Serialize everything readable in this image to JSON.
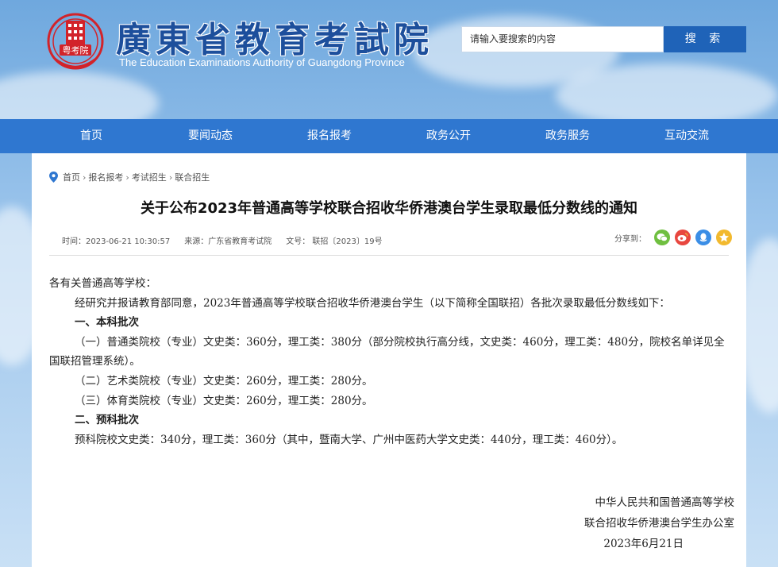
{
  "header": {
    "site_title": "廣東省教育考試院",
    "site_subtitle": "The Education Examinations Authority of Guangdong Province",
    "emblem_text": "粤考院",
    "search_value": "请输入要搜索的内容",
    "search_button": "搜 索"
  },
  "nav": {
    "items": [
      "首页",
      "要闻动态",
      "报名报考",
      "政务公开",
      "政务服务",
      "互动交流"
    ]
  },
  "breadcrumb": [
    "首页",
    "报名报考",
    "考试招生",
    "联合招生"
  ],
  "article": {
    "title": "关于公布2023年普通高等学校联合招收华侨港澳台学生录取最低分数线的通知",
    "meta": {
      "time": "时间：2023-06-21 10:30:57",
      "source": "来源：广东省教育考试院",
      "doc_no": "文号：  联招〔2023〕19号"
    },
    "share_label": "分享到：",
    "paragraphs": [
      "各有关普通高等学校：",
      "经研究并报请教育部同意，2023年普通高等学校联合招收华侨港澳台学生（以下简称全国联招）各批次录取最低分数线如下：",
      "一、本科批次",
      "（一）普通类院校（专业）文史类：360分，理工类：380分（部分院校执行高分线，文史类：460分，理工类：480分，院校名单详见全国联招管理系统）。",
      "（二）艺术类院校（专业）文史类：260分，理工类：280分。",
      "（三）体育类院校（专业）文史类：260分，理工类：280分。",
      "二、预科批次",
      "预科院校文史类：340分，理工类：360分（其中，暨南大学、广州中医药大学文史类：440分，理工类：460分）。"
    ],
    "signature": [
      "中华人民共和国普通高等学校",
      "联合招收华侨港澳台学生办公室",
      "2023年6月21日"
    ]
  },
  "colors": {
    "nav_bg": "#2f77d0",
    "search_btn": "#1f63b8",
    "title_blue": "#1d4f9c",
    "emblem_red": "#d2232a"
  },
  "icons": [
    "location-pin-icon",
    "wechat-icon",
    "weibo-icon",
    "qq-icon",
    "qzone-icon"
  ]
}
